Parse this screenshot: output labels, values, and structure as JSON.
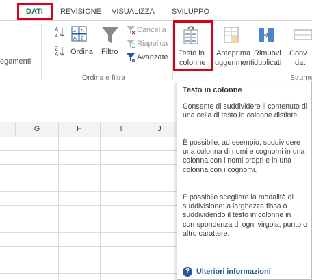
{
  "ribbon": {
    "tabs": [
      "DATI",
      "REVISIONE",
      "VISUALIZZA",
      "SVILUPPO"
    ],
    "left_partial_label": "egamenti",
    "sort": {
      "az_top": "A Z",
      "za_bottom": "Z A",
      "label": "Ordina"
    },
    "filter": {
      "label": "Filtro",
      "cancella": "Cancella",
      "riapplica": "Riapplica",
      "avanzate": "Avanzate"
    },
    "group_sort_filter": "Ordina e filtra",
    "testo_in_colonne": {
      "line1": "Testo in",
      "line2": "colonne"
    },
    "anteprima": {
      "line1": "Anteprima",
      "line2": "uggerimenti"
    },
    "rimuovi": {
      "line1": "Rimuovi",
      "line2": "duplicati"
    },
    "conv": {
      "line1": "Conv",
      "line2": "dat"
    },
    "group_strumenti": "Strume"
  },
  "sheet": {
    "columns": [
      "G",
      "H",
      "I",
      "J"
    ]
  },
  "tooltip": {
    "title": "Testo in colonne",
    "p1": "Consente di suddividere il contenuto di una cella di testo in colonne distinte.",
    "p2": "È possibile, ad esempio, suddividere una colonna di nomi e cognomi in una colonna con i nomi propri e in una colonna con i cognomi.",
    "p3": "È possibile scegliere la modalità di suddivisione: a larghezza fissa o suddividendo il testo in colonne in corrispondenza di ogni virgola, punto o altro carattere.",
    "help_link": "Ulteriori informazioni"
  },
  "colors": {
    "accent_red": "#d9001b",
    "excel_green": "#217346",
    "link_blue": "#2b579a"
  }
}
